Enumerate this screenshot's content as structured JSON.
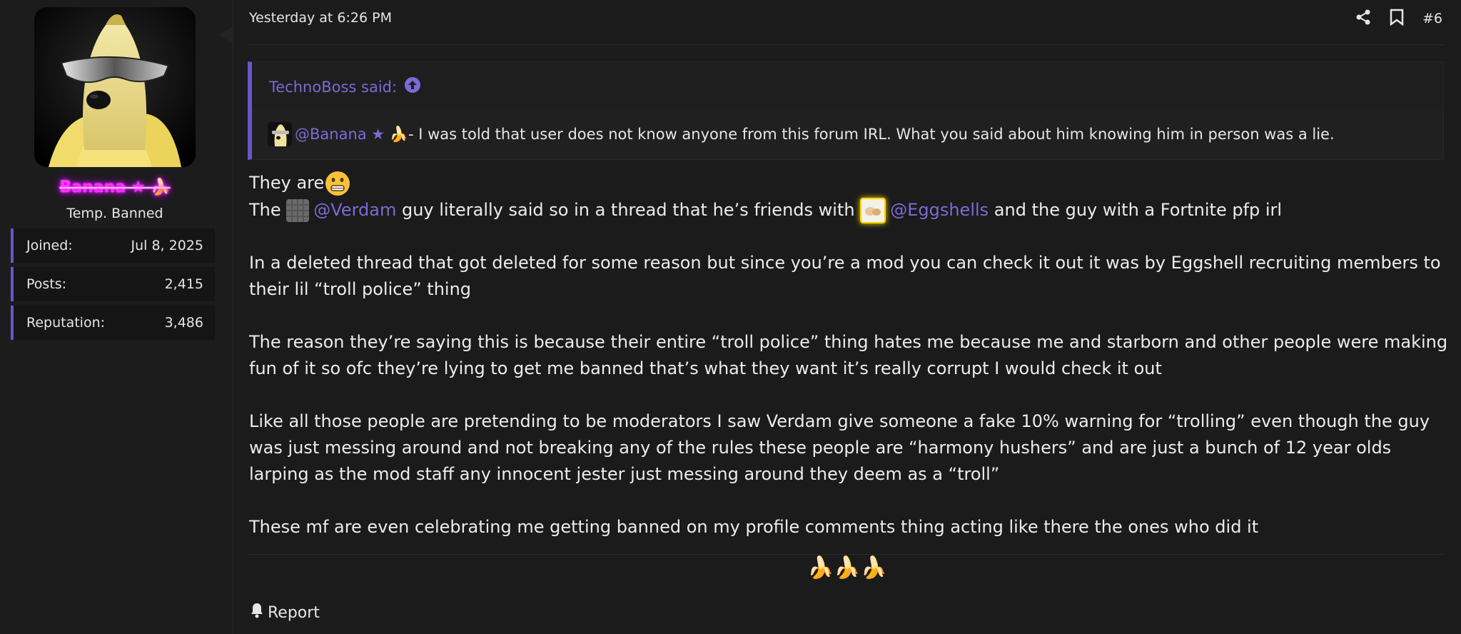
{
  "user": {
    "name": "Banana ★ 🍌",
    "title": "Temp. Banned",
    "stats": [
      {
        "label": "Joined:",
        "value": "Jul 8, 2025"
      },
      {
        "label": "Posts:",
        "value": "2,415"
      },
      {
        "label": "Reputation:",
        "value": "3,486"
      }
    ]
  },
  "post": {
    "date": "Yesterday at 6:26 PM",
    "number": "#6",
    "actions": [
      "share-icon",
      "bookmark-icon"
    ],
    "quote": {
      "author": "TechnoBoss said:",
      "mention": "@Banana ★ 🍌",
      "text": " - I was told that user does not know anyone from this forum IRL. What you said about him knowing him in person was a lie."
    },
    "body": {
      "line1": "They are",
      "line2_pre": "The ",
      "mention1": "@Verdam",
      "line2_mid": " guy literally said so in a thread that he’s friends with ",
      "mention2": "@Eggshells",
      "line2_post": " and the guy with a Fortnite pfp irl",
      "para2": "In a deleted thread that got deleted for some reason but since you’re a mod you can check it out it was by Eggshell recruiting members to their lil “troll police” thing",
      "para3": "The reason they’re saying this is because their entire “troll police” thing hates me because me and starborn and other people were making fun of it so ofc they’re lying to get me banned that’s what they want it’s really corrupt I would check it out",
      "para4": "Like all those people are pretending to be moderators I saw Verdam give someone a fake 10% warning for “trolling” even though the guy was just messing around and not breaking any of the rules these people are “harmony hushers” and are just a bunch of 12 year olds larping as the mod staff any innocent jester just messing around they deem as a “troll”",
      "para5": "These mf are even celebrating me getting banned on my profile comments thing acting like there the ones who did it"
    },
    "signature": "🍌🍌🍌",
    "report_label": "Report"
  },
  "colors": {
    "accent": "#6a55c8",
    "mention": "#7b6ad6",
    "username_glow": "#ff00ff",
    "background": "#1b1b1b"
  }
}
